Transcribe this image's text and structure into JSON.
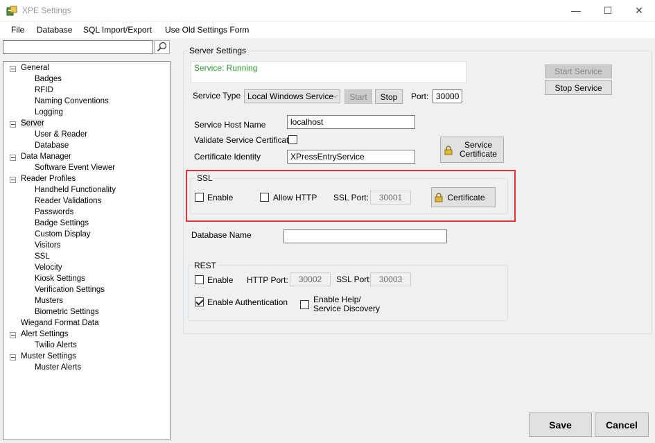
{
  "window": {
    "title": "XPE Settings",
    "minimize": "—",
    "maximize": "☐",
    "close": "✕"
  },
  "menu": [
    "File",
    "Database",
    "SQL Import/Export",
    "Use Old Settings Form"
  ],
  "search": {
    "value": "",
    "placeholder": ""
  },
  "tree": {
    "general": "General",
    "badges": "Badges",
    "rfid": "RFID",
    "naming_conventions": "Naming Conventions",
    "logging": "Logging",
    "server": "Server",
    "user_reader": "User & Reader",
    "database": "Database",
    "data_manager": "Data Manager",
    "software_event_viewer": "Software Event Viewer",
    "reader_profiles": "Reader Profiles",
    "handheld_functionality": "Handheld Functionality",
    "reader_validations": "Reader Validations",
    "passwords": "Passwords",
    "badge_settings": "Badge Settings",
    "custom_display": "Custom Display",
    "visitors": "Visitors",
    "ssl": "SSL",
    "velocity": "Velocity",
    "kiosk_settings": "Kiosk Settings",
    "verification_settings": "Verification Settings",
    "musters": "Musters",
    "biometric_settings": "Biometric Settings",
    "wiegand_format_data": "Wiegand Format Data",
    "alert_settings": "Alert Settings",
    "twilio_alerts": "Twilio Alerts",
    "muster_settings": "Muster Settings",
    "muster_alerts": "Muster Alerts"
  },
  "server_settings": {
    "group_title": "Server Settings",
    "status": "Service: Running",
    "service_type_label": "Service Type",
    "service_type_value": "Local Windows Service",
    "start_label": "Start",
    "stop_label": "Stop",
    "port_label": "Port:",
    "port_value": "30000",
    "start_service_label": "Start Service",
    "stop_service_label": "Stop Service",
    "host_name_label": "Service Host Name",
    "host_name_value": "localhost",
    "validate_cert_label": "Validate Service Certificate",
    "validate_cert_checked": false,
    "cert_identity_label": "Certificate Identity",
    "cert_identity_value": "XPressEntryService",
    "service_certificate_line1": "Service",
    "service_certificate_line2": "Certificate"
  },
  "ssl": {
    "group_title": "SSL",
    "enable_label": "Enable",
    "enable_checked": false,
    "allow_http_label": "Allow HTTP",
    "allow_http_checked": false,
    "ssl_port_label": "SSL Port:",
    "ssl_port_value": "30001",
    "certificate_label": "Certificate"
  },
  "database_name": {
    "label": "Database Name",
    "value": ""
  },
  "rest": {
    "group_title": "REST",
    "enable_label": "Enable",
    "enable_checked": false,
    "http_port_label": "HTTP Port:",
    "http_port_value": "30002",
    "ssl_port_label": "SSL Port:",
    "ssl_port_value": "30003",
    "enable_auth_label": "Enable Authentication",
    "enable_auth_checked": true,
    "help_line1": "Enable Help/",
    "help_line2": "Service Discovery",
    "help_checked": false
  },
  "footer": {
    "save_label": "Save",
    "cancel_label": "Cancel"
  },
  "colors": {
    "highlight": "#e53238",
    "status_green": "#2b9b2b"
  }
}
